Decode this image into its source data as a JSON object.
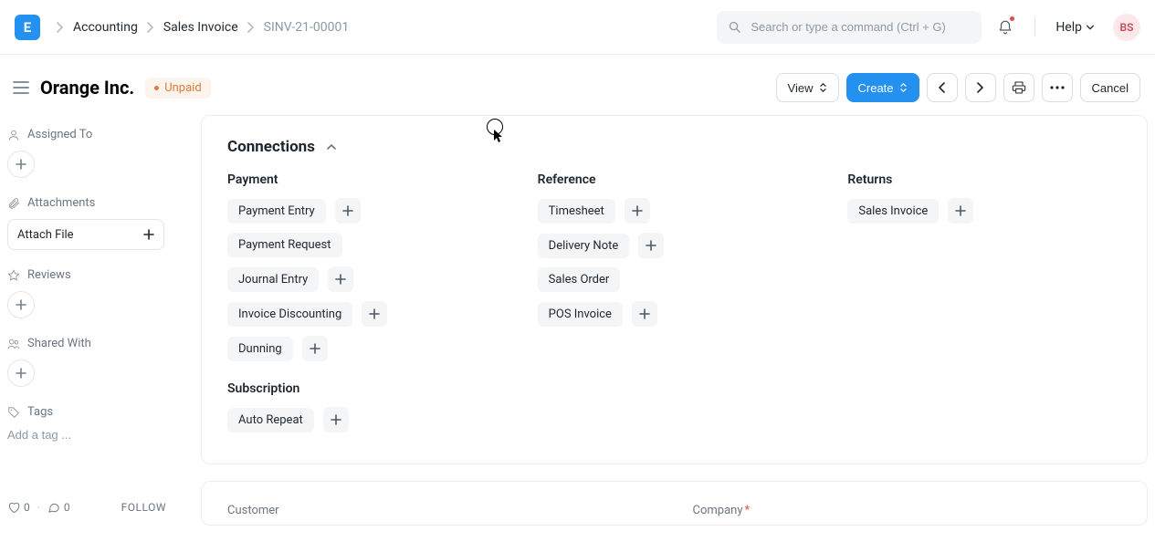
{
  "topbar": {
    "logo_letter": "E",
    "breadcrumb": [
      "Accounting",
      "Sales Invoice",
      "SINV-21-00001"
    ],
    "search_placeholder": "Search or type a command (Ctrl + G)",
    "help_label": "Help",
    "avatar_initials": "BS"
  },
  "header": {
    "title": "Orange Inc.",
    "status": "Unpaid",
    "view_label": "View",
    "create_label": "Create",
    "cancel_label": "Cancel"
  },
  "sidebar": {
    "assigned_to_label": "Assigned To",
    "attachments_label": "Attachments",
    "attach_file_label": "Attach File",
    "reviews_label": "Reviews",
    "shared_with_label": "Shared With",
    "tags_label": "Tags",
    "tag_placeholder": "Add a tag ...",
    "like_count": "0",
    "comment_count": "0",
    "follow_label": "FOLLOW"
  },
  "connections": {
    "title": "Connections",
    "groups": [
      {
        "title": "Payment",
        "items": [
          {
            "label": "Payment Entry",
            "addable": true
          },
          {
            "label": "Payment Request",
            "addable": false
          },
          {
            "label": "Journal Entry",
            "addable": true
          },
          {
            "label": "Invoice Discounting",
            "addable": true
          },
          {
            "label": "Dunning",
            "addable": true
          }
        ],
        "subgroup": {
          "title": "Subscription",
          "items": [
            {
              "label": "Auto Repeat",
              "addable": true
            }
          ]
        }
      },
      {
        "title": "Reference",
        "items": [
          {
            "label": "Timesheet",
            "addable": true
          },
          {
            "label": "Delivery Note",
            "addable": true
          },
          {
            "label": "Sales Order",
            "addable": false
          },
          {
            "label": "POS Invoice",
            "addable": true
          }
        ]
      },
      {
        "title": "Returns",
        "items": [
          {
            "label": "Sales Invoice",
            "addable": true
          }
        ]
      }
    ]
  },
  "form": {
    "customer_label": "Customer",
    "company_label": "Company"
  }
}
